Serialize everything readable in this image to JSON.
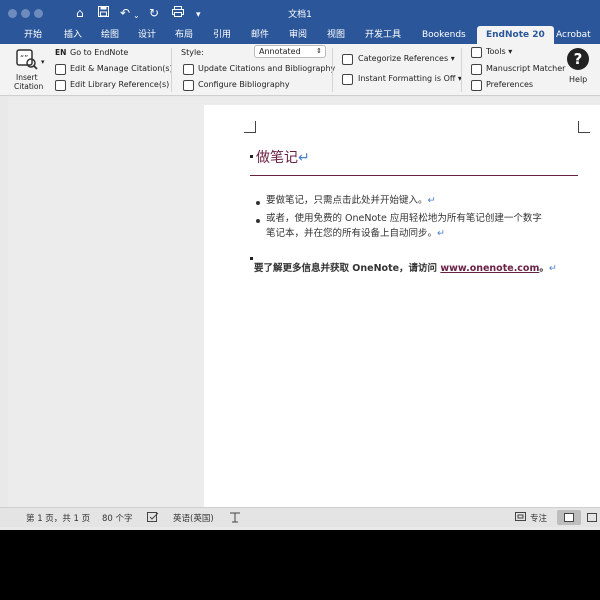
{
  "window": {
    "title": "文档1",
    "quick_access": [
      "home-icon",
      "save-icon",
      "undo-icon",
      "redo-icon",
      "print-icon",
      "customize-icon"
    ]
  },
  "tabs": [
    "开始",
    "插入",
    "绘图",
    "设计",
    "布局",
    "引用",
    "邮件",
    "审阅",
    "视图",
    "开发工具",
    "Bookends",
    "EndNote 20",
    "Acrobat"
  ],
  "active_tab": "EndNote 20",
  "ribbon": {
    "insert_citation": "Insert\nCitation",
    "insert_citation_line1": "Insert",
    "insert_citation_line2": "Citation",
    "go_to_endnote": "Go to EndNote",
    "go_to_endnote_badge": "EN",
    "edit_manage": "Edit & Manage Citation(s)",
    "edit_library": "Edit Library Reference(s)",
    "style_label": "Style:",
    "style_value": "Annotated",
    "update_citations": "Update Citations and Bibliography",
    "configure_bibliography": "Configure Bibliography",
    "categorize_references": "Categorize References",
    "instant_formatting": "Instant Formatting is Off",
    "tools": "Tools",
    "manuscript_matcher": "Manuscript Matcher",
    "preferences": "Preferences",
    "help": "Help"
  },
  "document": {
    "heading": "做笔记",
    "bullets": [
      "要做笔记，只需点击此处并开始键入。",
      "或者，使用免费的 OneNote 应用轻松地为所有笔记创建一个数字",
      "笔记本，并在您的所有设备上自动同步。"
    ],
    "info_text": "要了解更多信息并获取 OneNote，请访问 ",
    "info_link": "www.onenote.com",
    "info_end": "。",
    "para_mark": "↵"
  },
  "status": {
    "page": "第 1 页，共 1 页",
    "words": "80 个字",
    "language": "英语(英国)",
    "focus": "专注"
  },
  "colors": {
    "accent": "#2b579a",
    "heading": "#6a2244"
  }
}
